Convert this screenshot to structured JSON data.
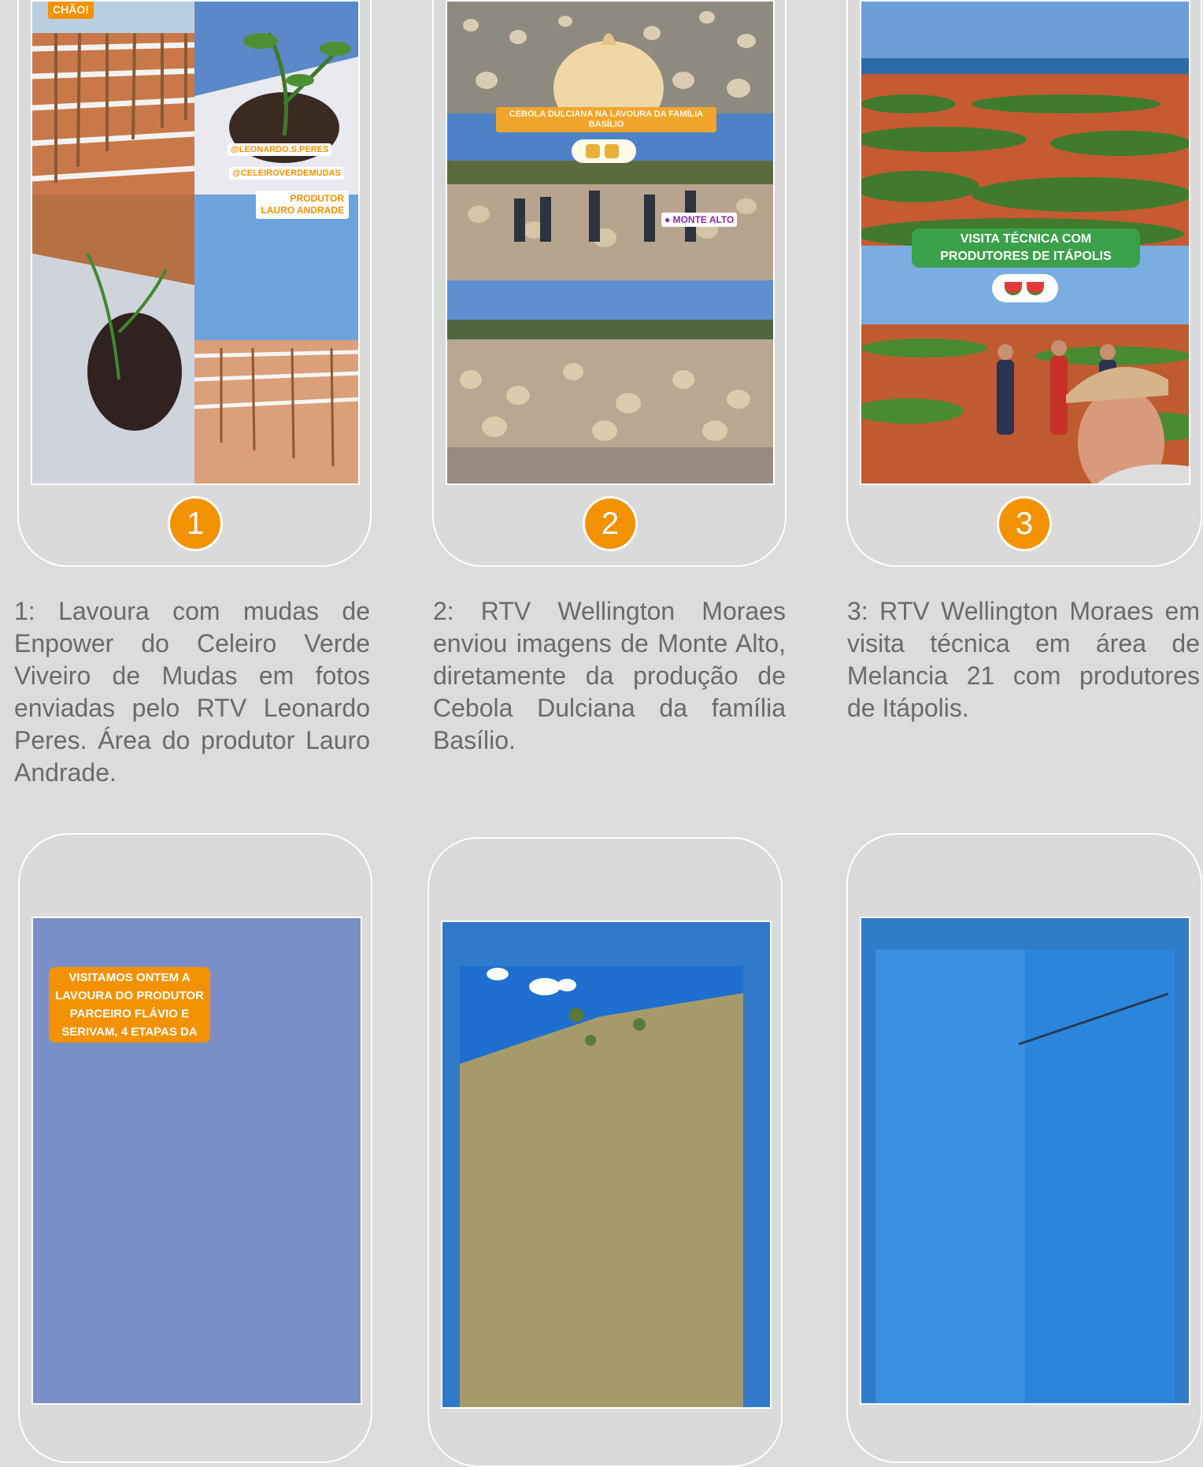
{
  "cards": [
    {
      "number": "1",
      "caption": "1: Lavoura com mudas de Enpower do Celeiro Verde Viveiro de Mudas em fotos enviadas pelo RTV Leonardo Peres. Área do produtor Lauro Andrade.",
      "overlay": {
        "corner_tag": "CHÃO!",
        "handle_1": "@LEONARDO.S.PERES",
        "handle_2": "@CELEIROVERDEMUDAS",
        "producer_line_1": "PRODUTOR",
        "producer_line_2": "LAURO ANDRADE"
      }
    },
    {
      "number": "2",
      "caption": "2: RTV Wellington Moraes enviou imagens de Monte Alto, diretamente da produção de Cebola Dulciana da família Basílio.",
      "overlay": {
        "banner": "CEBOLA DULCIANA NA LAVOURA DA FAMÍLIA BASÍLIO",
        "location": "MONTE ALTO"
      }
    },
    {
      "number": "3",
      "caption": "3: RTV Wellington Moraes em visita técnica em área de Melancia 21 com produtores de Itápolis.",
      "overlay": {
        "banner_line_1": "VISITA TÉCNICA COM",
        "banner_line_2": "PRODUTORES DE ITÁPOLIS"
      }
    },
    {
      "overlay": {
        "line_1": "VISITAMOS ONTEM A",
        "line_2": "LAVOURA DO PRODUTOR",
        "line_3": "PARCEIRO FLÁVIO E",
        "line_4": "SERIVAM, 4 ETAPAS DA"
      }
    },
    {},
    {}
  ],
  "colors": {
    "badge": "#f39200",
    "background": "#dcdcdc",
    "frame": "#ffffff",
    "caption": "#6a6a6a"
  }
}
